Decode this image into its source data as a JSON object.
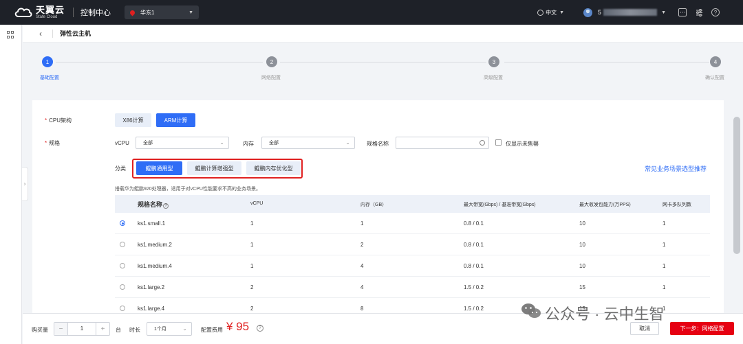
{
  "topbar": {
    "logo_cn": "天翼云",
    "logo_en": "State Cloud",
    "console_label": "控制中心",
    "region": "华东1",
    "language": "中文",
    "user_initial": "5"
  },
  "header": {
    "title": "弹性云主机"
  },
  "steps": [
    {
      "number": "1",
      "label": "基础配置",
      "active": true
    },
    {
      "number": "2",
      "label": "网络配置",
      "active": false
    },
    {
      "number": "3",
      "label": "高级配置",
      "active": false
    },
    {
      "number": "4",
      "label": "确认配置",
      "active": false
    }
  ],
  "form": {
    "cpu_arch_label": "CPU架构",
    "cpu_arch_options": [
      "X86计算",
      "ARM计算"
    ],
    "cpu_arch_selected": "ARM计算",
    "spec_label": "规格",
    "vcpu_label": "vCPU",
    "vcpu_value": "全部",
    "memory_label": "内存",
    "memory_value": "全部",
    "spec_name_label": "规格名称",
    "spec_name_value": "",
    "only_onsale_label": "仅显示未售罄",
    "category_label": "分类",
    "categories": [
      "鲲鹏通用型",
      "鲲鹏计算增强型",
      "鲲鹏内存优化型"
    ],
    "category_selected": "鲲鹏通用型",
    "recommend_link": "常见业务场景选型推荐",
    "description": "搭载华为鲲鹏920处理器，适用于对vCPU性能要求不高的业务场景。"
  },
  "table": {
    "headers": [
      "规格名称",
      "vCPU",
      "内存（GB）",
      "最大带宽(Gbps) / 基准带宽(Gbps)",
      "最大收发包能力(万PPS)",
      "网卡多队列数"
    ],
    "rows": [
      {
        "selected": true,
        "name": "ks1.small.1",
        "vcpu": "1",
        "memory": "1",
        "bandwidth": "0.8 / 0.1",
        "pps": "10",
        "queues": "1"
      },
      {
        "selected": false,
        "name": "ks1.medium.2",
        "vcpu": "1",
        "memory": "2",
        "bandwidth": "0.8 / 0.1",
        "pps": "10",
        "queues": "1"
      },
      {
        "selected": false,
        "name": "ks1.medium.4",
        "vcpu": "1",
        "memory": "4",
        "bandwidth": "0.8 / 0.1",
        "pps": "10",
        "queues": "1"
      },
      {
        "selected": false,
        "name": "ks1.large.2",
        "vcpu": "2",
        "memory": "4",
        "bandwidth": "1.5 / 0.2",
        "pps": "15",
        "queues": "1"
      },
      {
        "selected": false,
        "name": "ks1.large.4",
        "vcpu": "2",
        "memory": "8",
        "bandwidth": "1.5 / 0.2",
        "pps": "15",
        "queues": "1"
      }
    ]
  },
  "footer": {
    "quantity_label": "购买量",
    "quantity_value": "1",
    "unit": "台",
    "duration_label": "时长",
    "duration_value": "1个月",
    "fee_label": "配置费用",
    "price": "¥ 95",
    "cancel_label": "取消",
    "next_label": "下一步：网络配置"
  },
  "watermark": "公众号 · 云中生智",
  "colors": {
    "primary": "#2f6df6",
    "danger": "#e60012",
    "topbar": "#1e2128"
  }
}
